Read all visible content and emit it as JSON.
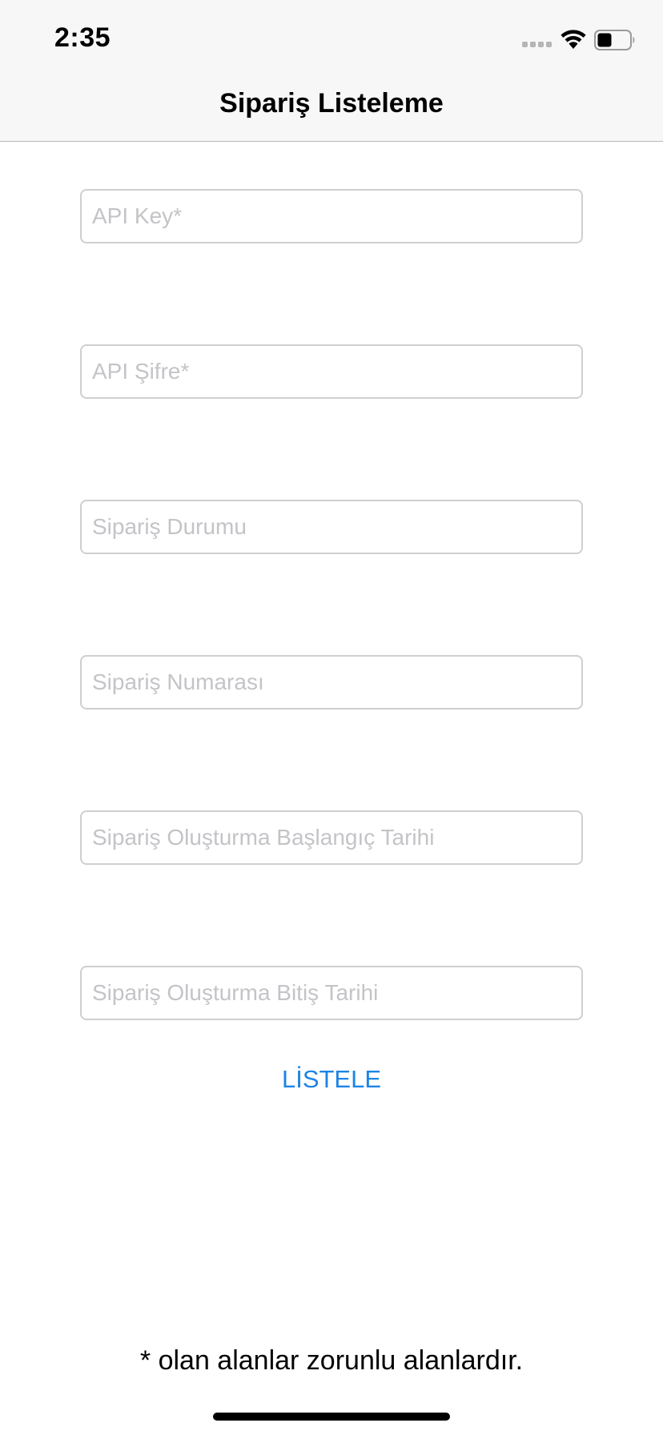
{
  "status_bar": {
    "time": "2:35",
    "icons": [
      "signal-dots-icon",
      "wifi-icon",
      "battery-icon"
    ]
  },
  "nav": {
    "title": "Sipariş Listeleme"
  },
  "form": {
    "fields": [
      {
        "placeholder": "API Key*",
        "value": ""
      },
      {
        "placeholder": "API Şifre*",
        "value": ""
      },
      {
        "placeholder": "Sipariş Durumu",
        "value": ""
      },
      {
        "placeholder": "Sipariş Numarası",
        "value": ""
      },
      {
        "placeholder": "Sipariş Oluşturma Başlangıç Tarihi",
        "value": ""
      },
      {
        "placeholder": "Sipariş Oluşturma Bitiş Tarihi",
        "value": ""
      }
    ],
    "submit_label": "LİSTELE"
  },
  "footnote": "* olan alanlar zorunlu alanlardır.",
  "colors": {
    "accent": "#1d84e6",
    "placeholder": "#c4c4c8",
    "field_border": "#cfcfcf",
    "nav_background": "#f7f7f7"
  }
}
